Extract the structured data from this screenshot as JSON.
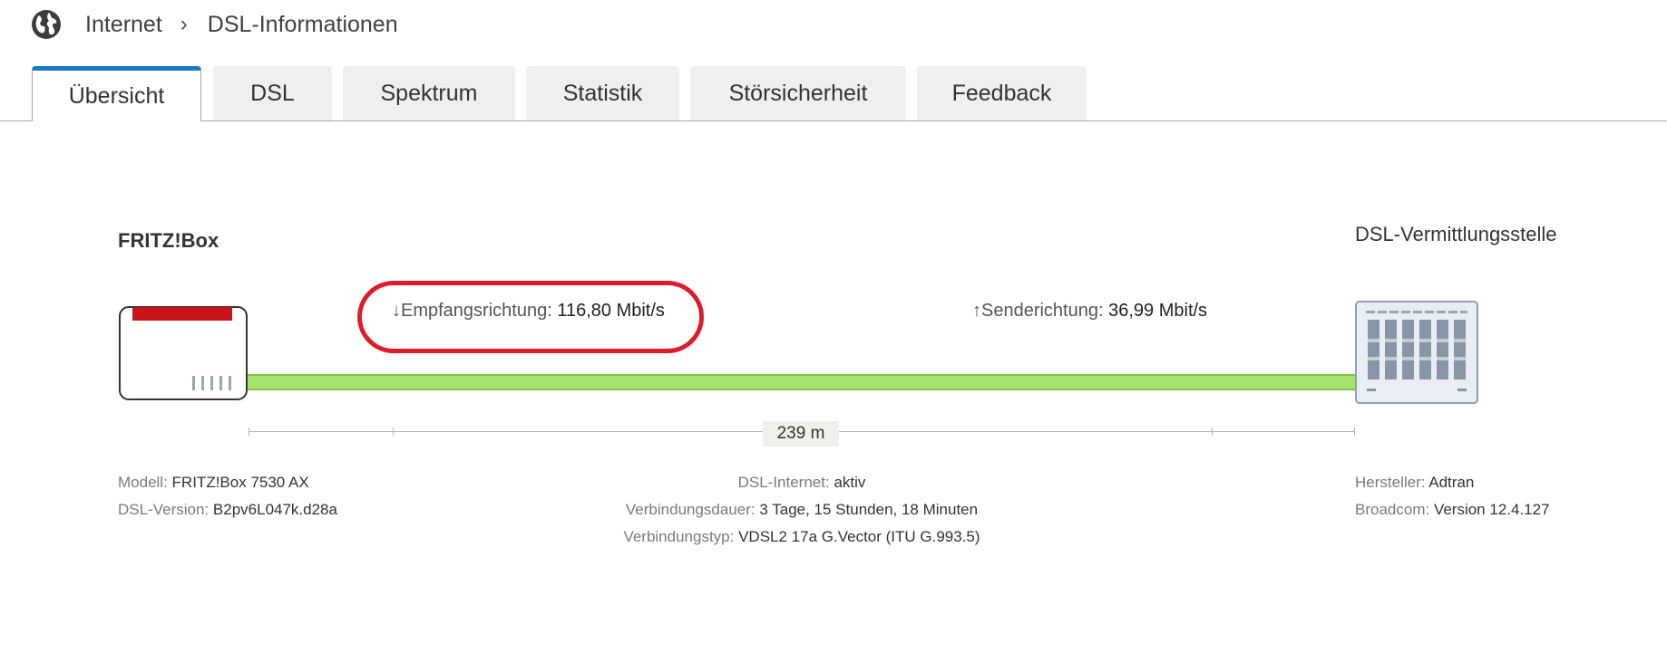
{
  "breadcrumb": {
    "icon": "globe-icon",
    "parent": "Internet",
    "separator": "›",
    "current": "DSL-Informationen"
  },
  "tabs": [
    {
      "label": "Übersicht",
      "active": true
    },
    {
      "label": "DSL",
      "active": false
    },
    {
      "label": "Spektrum",
      "active": false
    },
    {
      "label": "Statistik",
      "active": false
    },
    {
      "label": "Störsicherheit",
      "active": false
    },
    {
      "label": "Feedback",
      "active": false
    }
  ],
  "diagram": {
    "left_device": "FRITZ!Box",
    "right_device": "DSL-Vermittlungsstelle",
    "downstream": {
      "arrow": "↓",
      "label": "Empfangsrichtung:",
      "value": "116,80 Mbit/s"
    },
    "upstream": {
      "arrow": "↑",
      "label": "Senderichtung:",
      "value": "36,99 Mbit/s"
    },
    "distance": "239 m",
    "line_color": "#a5e26e",
    "highlight_color": "#dd1b2a"
  },
  "info_left": [
    {
      "key": "Modell:",
      "value": "FRITZ!Box 7530 AX"
    },
    {
      "key": "DSL-Version:",
      "value": "B2pv6L047k.d28a"
    }
  ],
  "info_center": [
    {
      "key": "DSL-Internet:",
      "value": "aktiv"
    },
    {
      "key": "Verbindungsdauer:",
      "value": "3 Tage, 15 Stunden, 18 Minuten"
    },
    {
      "key": "Verbindungstyp:",
      "value": "VDSL2 17a G.Vector (ITU G.993.5)"
    }
  ],
  "info_right": [
    {
      "key": "Hersteller:",
      "value": "Adtran"
    },
    {
      "key": "Broadcom:",
      "value": "Version 12.4.127"
    }
  ],
  "colors": {
    "accent": "#1d76c8",
    "router_red": "#c8151b"
  }
}
